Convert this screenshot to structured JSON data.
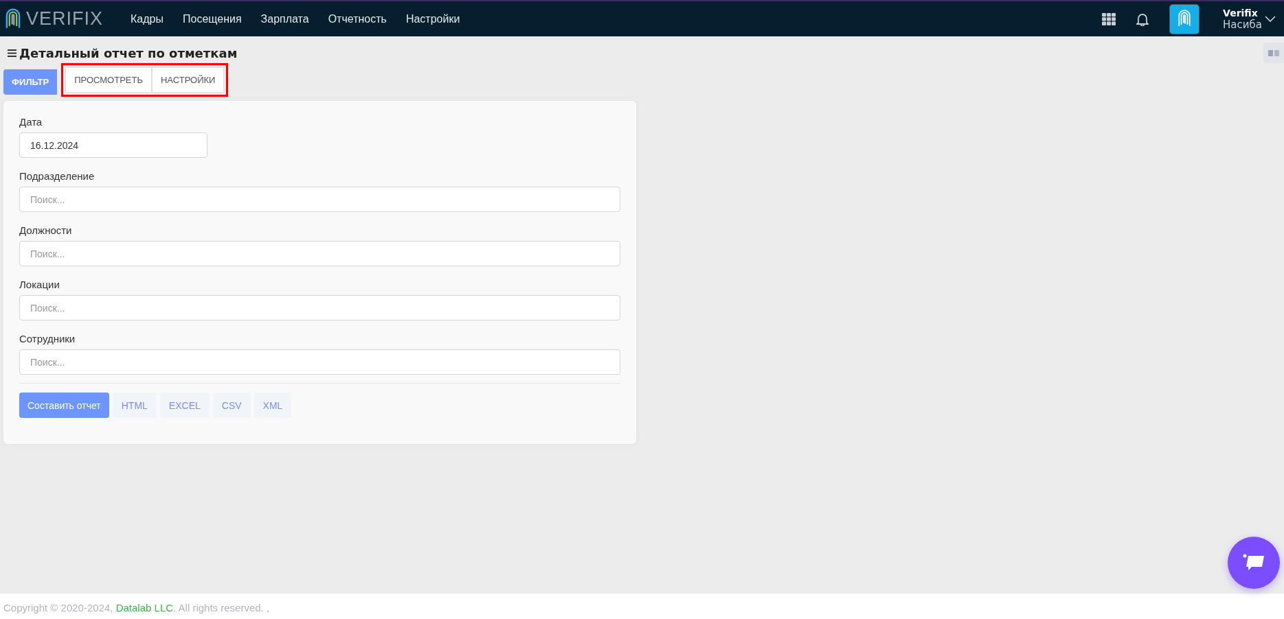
{
  "header": {
    "logo": "VERIFIX",
    "nav": [
      {
        "label": "Кадры"
      },
      {
        "label": "Посещения"
      },
      {
        "label": "Зарплата"
      },
      {
        "label": "Отчетность"
      },
      {
        "label": "Настройки"
      }
    ],
    "user": {
      "company": "Verifix",
      "name": "Насиба"
    }
  },
  "page": {
    "title": "Детальный отчет по отметкам"
  },
  "tabs": [
    {
      "label": "ФИЛЬТР",
      "selected": true,
      "highlighted": false
    },
    {
      "label": "ПРОСМОТРЕТЬ",
      "selected": false,
      "highlighted": true
    },
    {
      "label": "НАСТРОЙКИ",
      "selected": false,
      "highlighted": true
    }
  ],
  "form": {
    "fields": [
      {
        "label": "Дата",
        "kind": "date",
        "value": "16.12.2024"
      },
      {
        "label": "Подразделение",
        "kind": "search",
        "placeholder": "Поиск..."
      },
      {
        "label": "Должности",
        "kind": "search",
        "placeholder": "Поиск..."
      },
      {
        "label": "Локации",
        "kind": "search",
        "placeholder": "Поиск..."
      },
      {
        "label": "Сотрудники",
        "kind": "search",
        "placeholder": "Поиск..."
      }
    ],
    "buttons": [
      {
        "label": "Составить отчет",
        "kind": "primary"
      },
      {
        "label": "HTML",
        "kind": "format"
      },
      {
        "label": "EXCEL",
        "kind": "format"
      },
      {
        "label": "CSV",
        "kind": "format"
      },
      {
        "label": "XML",
        "kind": "format"
      }
    ]
  },
  "footer": {
    "before": "Copyright © 2020-2024,",
    "link": "Datalab LLC",
    "after": ". All rights reserved. ,"
  }
}
